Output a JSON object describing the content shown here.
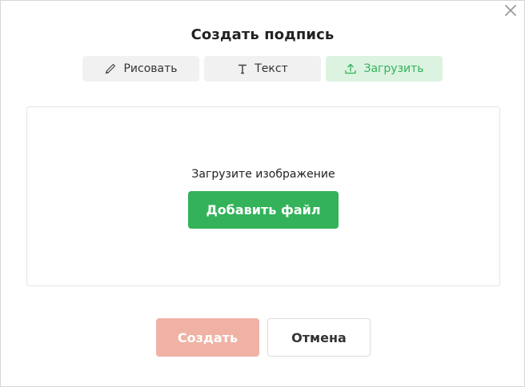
{
  "dialog": {
    "title": "Создать подпись",
    "close_icon": "close-icon"
  },
  "tabs": [
    {
      "label": "Рисовать",
      "icon": "pen-icon",
      "active": false
    },
    {
      "label": "Текст",
      "icon": "text-icon",
      "active": false
    },
    {
      "label": "Загрузить",
      "icon": "upload-icon",
      "active": true
    }
  ],
  "upload": {
    "prompt": "Загрузите изображение",
    "add_file_label": "Добавить файл"
  },
  "footer": {
    "create_label": "Создать",
    "cancel_label": "Отмена"
  },
  "colors": {
    "accent_green": "#33b25a",
    "active_tab_bg": "#dcf3e1",
    "create_disabled": "#f0b2a4"
  }
}
